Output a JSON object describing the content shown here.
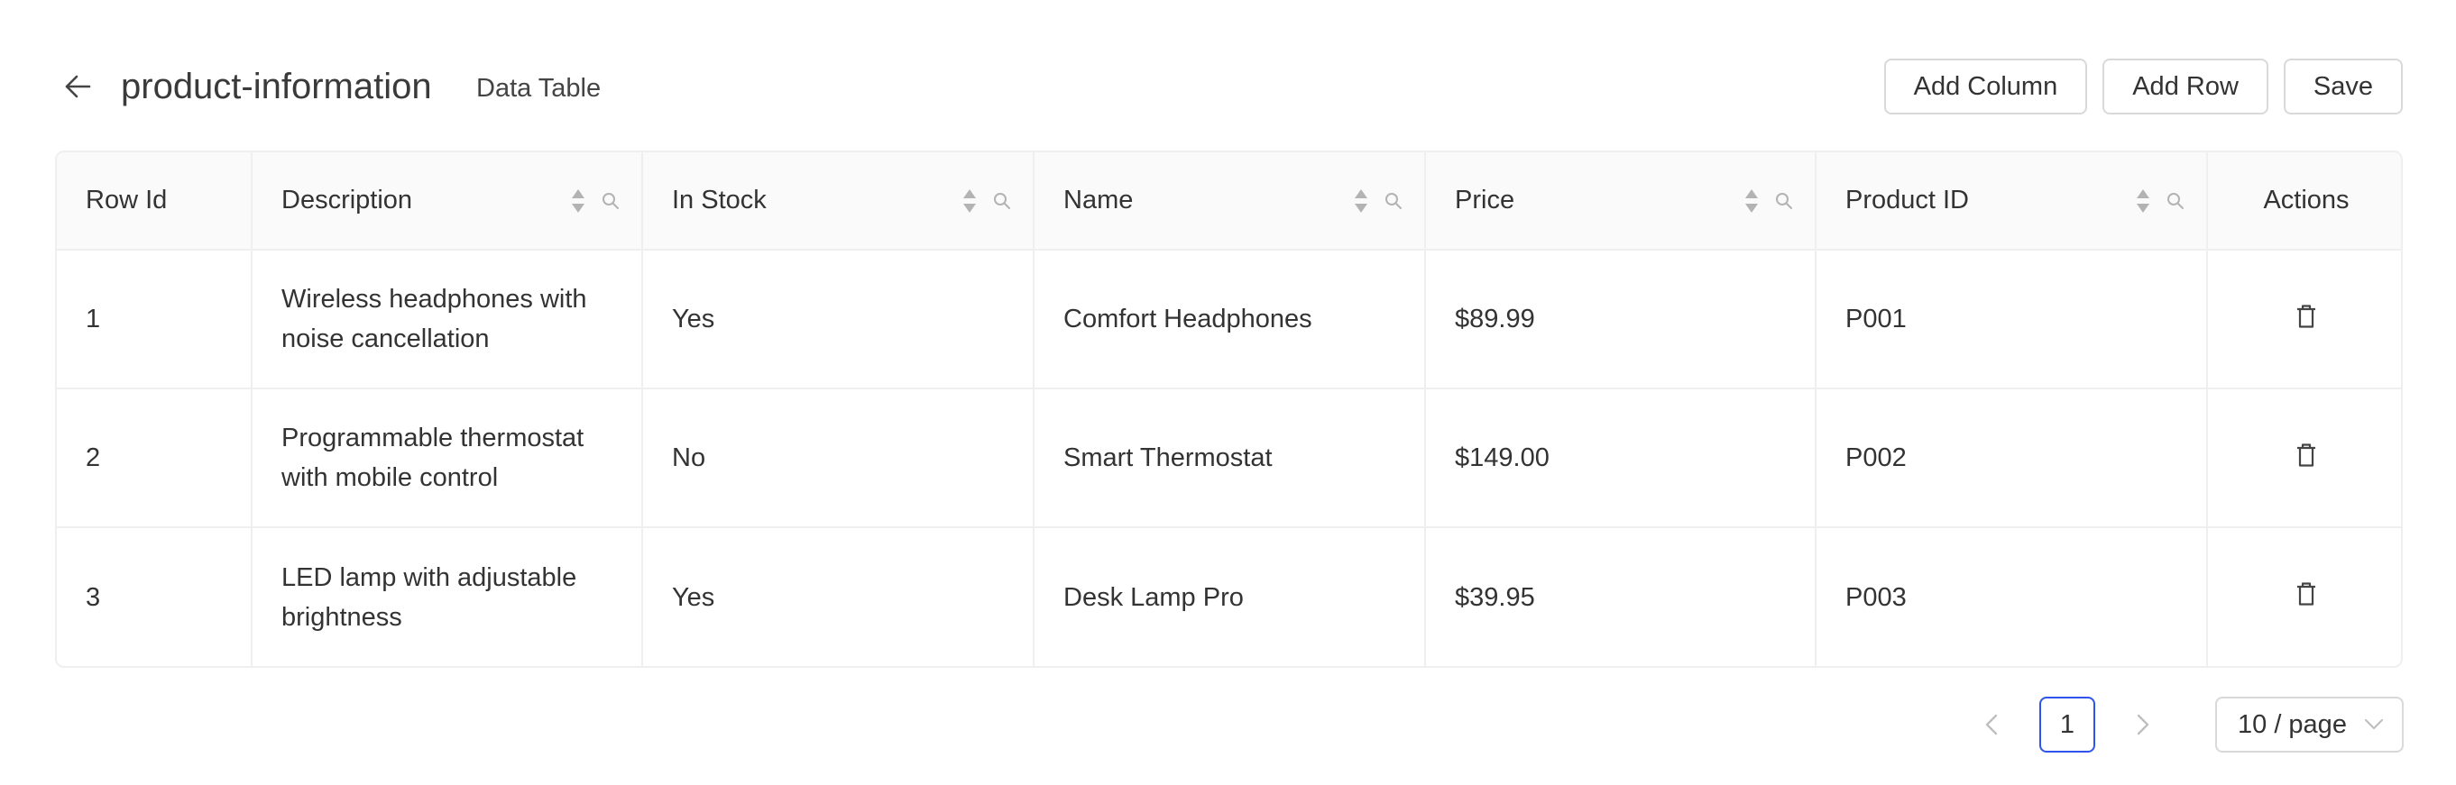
{
  "header": {
    "back_icon": "arrow-left-icon",
    "title": "product-information",
    "subtitle": "Data Table"
  },
  "toolbar": {
    "add_column_label": "Add Column",
    "add_row_label": "Add Row",
    "save_label": "Save"
  },
  "table": {
    "columns": [
      {
        "label": "Row Id",
        "sortable": false,
        "searchable": false
      },
      {
        "label": "Description",
        "sortable": true,
        "searchable": true
      },
      {
        "label": "In Stock",
        "sortable": true,
        "searchable": true
      },
      {
        "label": "Name",
        "sortable": true,
        "searchable": true
      },
      {
        "label": "Price",
        "sortable": true,
        "searchable": true
      },
      {
        "label": "Product ID",
        "sortable": true,
        "searchable": true
      },
      {
        "label": "Actions",
        "sortable": false,
        "searchable": false
      }
    ],
    "rows": [
      {
        "row_id": "1",
        "description": "Wireless headphones with noise cancellation",
        "in_stock": "Yes",
        "name": "Comfort Headphones",
        "price": "$89.99",
        "product_id": "P001"
      },
      {
        "row_id": "2",
        "description": "Programmable thermostat with mobile control",
        "in_stock": "No",
        "name": "Smart Thermostat",
        "price": "$149.00",
        "product_id": "P002"
      },
      {
        "row_id": "3",
        "description": "LED lamp with adjustable brightness",
        "in_stock": "Yes",
        "name": "Desk Lamp Pro",
        "price": "$39.95",
        "product_id": "P003"
      }
    ],
    "delete_icon": "trash-icon",
    "sort_icon": "sort-icon",
    "search_icon": "search-icon"
  },
  "pagination": {
    "current_page": "1",
    "page_size": "10 / page"
  },
  "colors": {
    "accent": "#2f54eb",
    "border": "#d9d9d9",
    "header_bg": "#fafafa",
    "icon": "#b3b3b3"
  }
}
